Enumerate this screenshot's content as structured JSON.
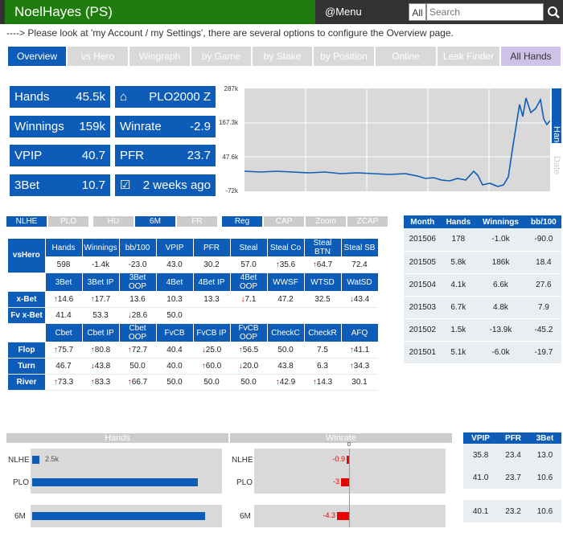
{
  "header": {
    "brand": "NoelHayes (PS)",
    "menu": "@Menu",
    "all_label": "All",
    "search_placeholder": "Search"
  },
  "notice": "----> Please look at 'my Account / my Settings', there are several options to configure the Overview page.",
  "tabs": [
    "Overview",
    "vs Hero",
    "Wingraph",
    "by Game",
    "by Stake",
    "by Position",
    "Online",
    "Leak Finder",
    "All Hands"
  ],
  "stats": {
    "hands_label": "Hands",
    "hands": "45.5k",
    "game": "PLO2000 Z",
    "winnings_label": "Winnings",
    "winnings": "159k",
    "winrate_label": "Winrate",
    "winrate": "-2.9",
    "vpip_label": "VPIP",
    "vpip": "40.7",
    "pfr_label": "PFR",
    "pfr": "23.7",
    "threebet_label": "3Bet",
    "threebet": "10.7",
    "last_seen": "2 weeks ago"
  },
  "chart": {
    "yticks": [
      "287k",
      "167.3k",
      "47.6k",
      "-72k"
    ],
    "side_label_1": "Hands",
    "side_label_2": "Date"
  },
  "filters": [
    "NLHE",
    "PLO",
    "HU",
    "6M",
    "FR",
    "Reg",
    "CAP",
    "Zoom",
    "ZCAP"
  ],
  "vshero": {
    "row_label": "vsHero",
    "headers": [
      "Hands",
      "Winnings",
      "bb/100",
      "VPIP",
      "PFR",
      "Steal",
      "Steal Co",
      "Steal BTN",
      "Steal SB"
    ],
    "values": [
      "598",
      "-1.4k",
      "-23.0",
      "43.0",
      "30.2",
      "57.0",
      "35.6",
      "64.7",
      "72.4"
    ]
  },
  "bet3": {
    "headers": [
      "3Bet",
      "3Bet IP",
      "3Bet OOP",
      "4Bet",
      "4Bet IP",
      "4Bet OOP",
      "WWSF",
      "WTSD",
      "WatSD"
    ],
    "rows": [
      {
        "label": "x-Bet",
        "values": [
          "14.6",
          "17.7",
          "13.6",
          "10.3",
          "13.3",
          "7.1",
          "47.2",
          "32.5",
          "43.4"
        ]
      },
      {
        "label": "Fv x-Bet",
        "values": [
          "41.4",
          "53.3",
          "28.6",
          "50.0",
          "",
          "",
          "",
          "",
          ""
        ]
      }
    ]
  },
  "cbet": {
    "headers": [
      "Cbet",
      "Cbet IP",
      "Cbet OOP",
      "FvCB",
      "FvCB IP",
      "FvCB OOP",
      "CheckC",
      "CheckR",
      "AFQ"
    ],
    "rows": [
      {
        "label": "Flop",
        "values": [
          "75.7",
          "80.8",
          "72.7",
          "40.4",
          "25.0",
          "56.5",
          "50.0",
          "7.5",
          "41.1"
        ]
      },
      {
        "label": "Turn",
        "values": [
          "46.7",
          "43.8",
          "50.0",
          "40.0",
          "60.0",
          "20.0",
          "43.8",
          "6.3",
          "34.3"
        ]
      },
      {
        "label": "River",
        "values": [
          "73.3",
          "83.3",
          "66.7",
          "50.0",
          "50.0",
          "50.0",
          "42.9",
          "14.3",
          "30.1"
        ]
      }
    ]
  },
  "months": {
    "headers": [
      "Month",
      "Hands",
      "Winnings",
      "bb/100"
    ],
    "rows": [
      [
        "201506",
        "178",
        "-1.0k",
        "-90.0"
      ],
      [
        "201505",
        "5.8k",
        "186k",
        "18.4"
      ],
      [
        "201504",
        "4.1k",
        "6.6k",
        "27.6"
      ],
      [
        "201503",
        "6.7k",
        "4.8k",
        "7.9"
      ],
      [
        "201502",
        "1.5k",
        "-13.9k",
        "-45.2"
      ],
      [
        "201501",
        "5.1k",
        "-6.0k",
        "-19.7"
      ]
    ]
  },
  "bottom": {
    "hands_title": "Hands",
    "winrate_title": "Winrate",
    "zero_label": "0",
    "rows": [
      {
        "label": "NLHE",
        "hands_text": "2.5k",
        "hands_frac": 0.04,
        "winrate": "-0.9"
      },
      {
        "label": "PLO",
        "hands_text": "",
        "hands_frac": 0.88,
        "winrate": "-3"
      },
      {
        "label": "6M",
        "hands_text": "",
        "hands_frac": 0.92,
        "winrate": "-4.3"
      }
    ]
  },
  "vptable": {
    "headers": [
      "VPIP",
      "PFR",
      "3Bet"
    ],
    "rows": [
      [
        "35.8",
        "23.4",
        "13.0"
      ],
      [
        "41.0",
        "23.7",
        "10.6"
      ],
      [
        "40.1",
        "23.2",
        "10.6"
      ]
    ]
  },
  "colors": {
    "accent": "#0d5db8",
    "brand": "#1e7d0e",
    "negative": "#d00"
  }
}
